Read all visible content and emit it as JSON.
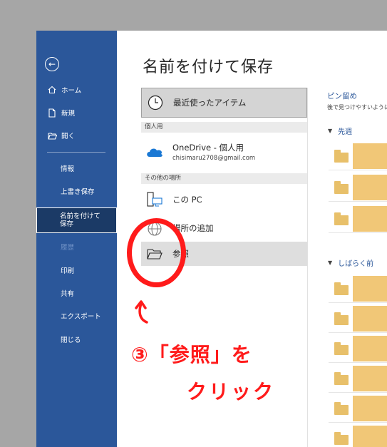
{
  "sidebar": {
    "back_icon": "back-arrow-icon",
    "items": [
      {
        "label": "ホーム",
        "icon": "home-icon"
      },
      {
        "label": "新規",
        "icon": "new-document-icon"
      },
      {
        "label": "開く",
        "icon": "open-folder-icon"
      },
      {
        "label": "情報"
      },
      {
        "label": "上書き保存"
      },
      {
        "label": "名前を付けて保存"
      },
      {
        "label": "履歴"
      },
      {
        "label": "印刷"
      },
      {
        "label": "共有"
      },
      {
        "label": "エクスポート"
      },
      {
        "label": "閉じる"
      }
    ]
  },
  "main": {
    "title": "名前を付けて保存",
    "recent_label": "最近使ったアイテム",
    "personal_header": "個人用",
    "onedrive_label": "OneDrive - 個人用",
    "onedrive_email": "chisimaru2708@gmail.com",
    "other_header": "その他の場所",
    "this_pc_label": "この PC",
    "add_place_label": "場所の追加",
    "browse_label": "参照"
  },
  "pinned": {
    "title": "ピン留め",
    "subtitle": "後で見つけやすいように",
    "group_last_week": "先週",
    "group_older": "しばらく前"
  },
  "annotation": {
    "line1": "③「参照」を",
    "line2": "クリック",
    "color": "#ff1b1b"
  },
  "colors": {
    "sidebar": "#2b579a",
    "selected": "#1b3a66",
    "accent": "#2b579a"
  }
}
